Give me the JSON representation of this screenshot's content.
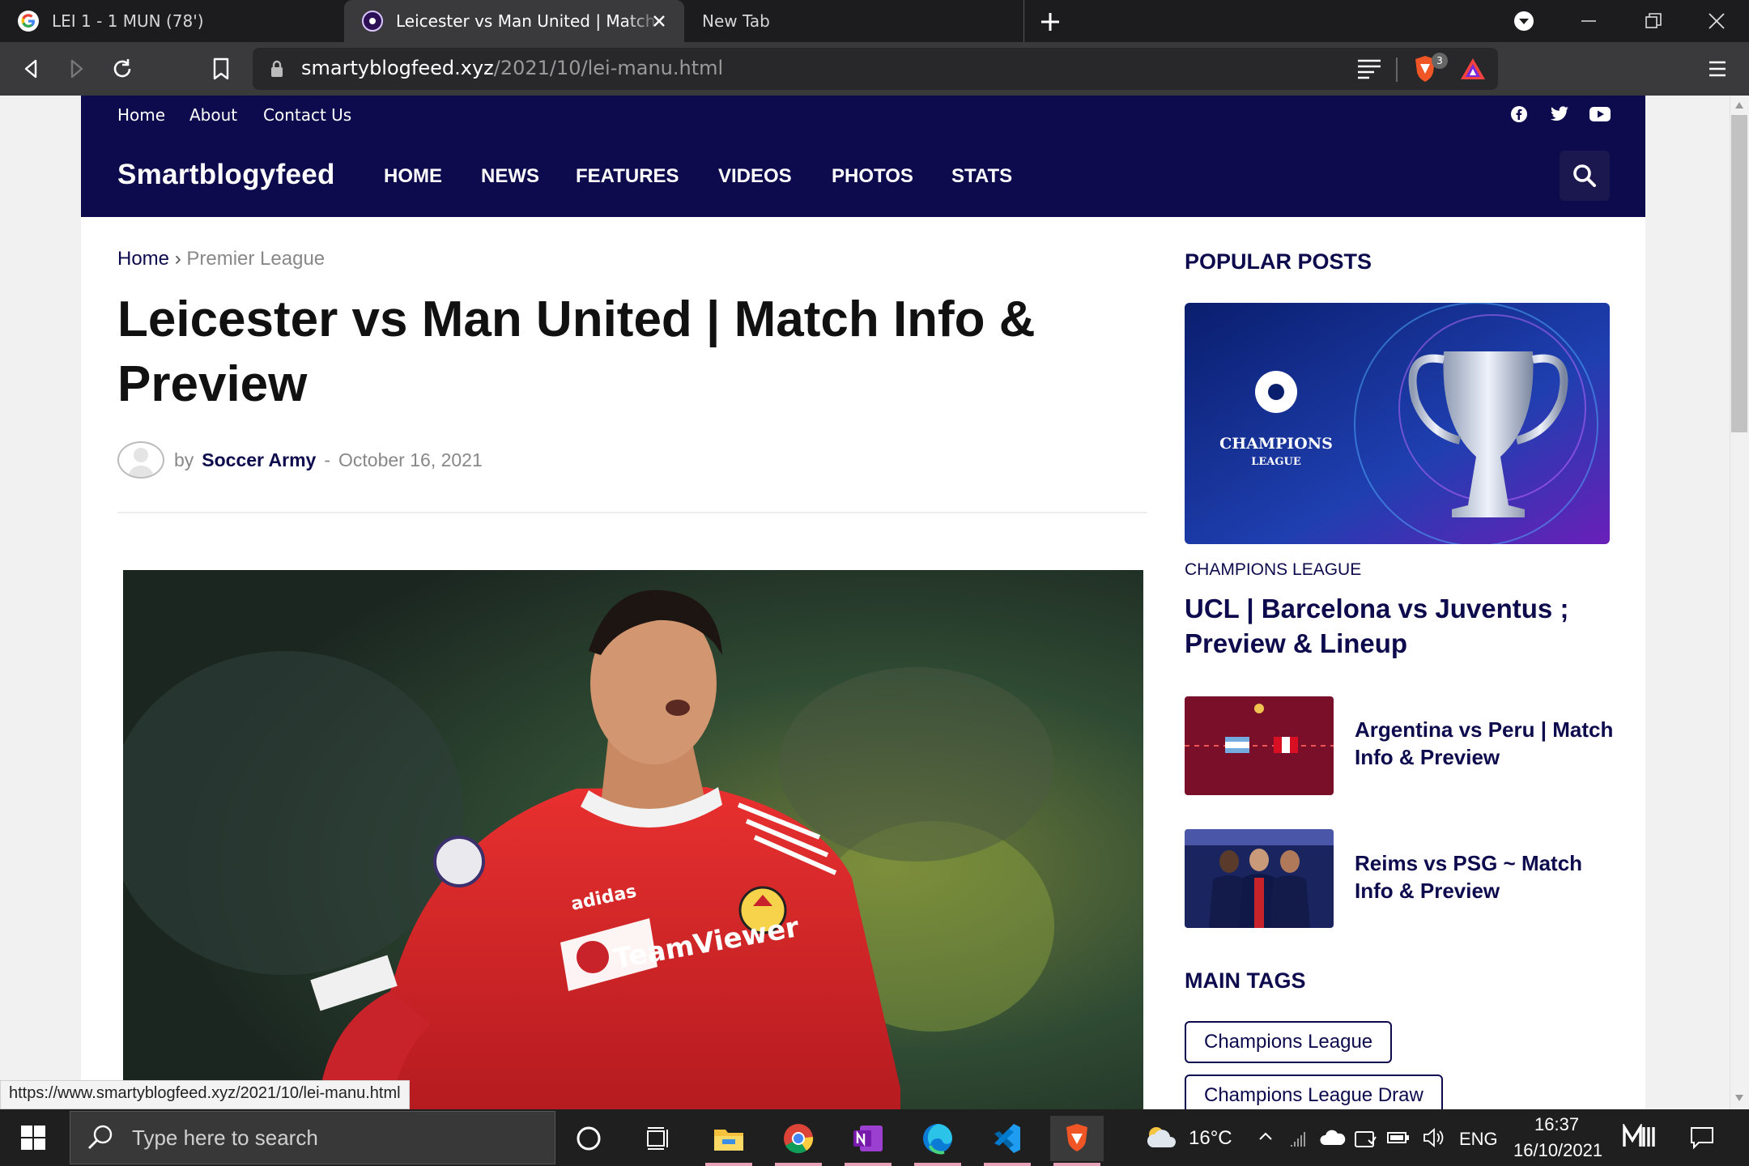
{
  "browser": {
    "tabs": [
      {
        "title": "LEI 1 - 1 MUN (78')",
        "active": false
      },
      {
        "title": "Leicester vs Man United | Match Info & Preview",
        "active": true
      },
      {
        "title": "New Tab",
        "active": false
      }
    ],
    "url_host": "smartyblogfeed.xyz",
    "url_path": "/2021/10/lei-manu.html",
    "shields_count": "3",
    "status_url": "https://www.smartyblogfeed.xyz/2021/10/lei-manu.html"
  },
  "site": {
    "top_links": [
      "Home",
      "About",
      "Contact Us"
    ],
    "social_icons": [
      "facebook-icon",
      "twitter-icon",
      "youtube-icon"
    ],
    "brand": "Smartblogyfeed",
    "nav": [
      "HOME",
      "NEWS",
      "FEATURES",
      "VIDEOS",
      "PHOTOS",
      "STATS"
    ],
    "accent_color": "#0d0b4d"
  },
  "article": {
    "breadcrumb_home": "Home",
    "breadcrumb_sep": "›",
    "breadcrumb_section": "Premier League",
    "title": "Leicester vs Man United | Match Info & Preview",
    "by": "by",
    "author": "Soccer Army",
    "dash": "-",
    "date": "October 16, 2021",
    "hero_kit_text": "TeamViewer"
  },
  "sidebar": {
    "popular_heading": "POPULAR POSTS",
    "featured_logo_text_1": "CHAMPIONS",
    "featured_logo_text_2": "LEAGUE",
    "featured_category": "CHAMPIONS LEAGUE",
    "featured_title": "UCL | Barcelona vs Juventus ; Preview & Lineup",
    "posts": [
      {
        "title": "Argentina vs Peru | Match Info & Preview"
      },
      {
        "title": "Reims vs PSG ~ Match Info & Preview"
      }
    ],
    "tags_heading": "MAIN TAGS",
    "tags": [
      "Champions League",
      "Champions League Draw"
    ]
  },
  "taskbar": {
    "search_placeholder": "Type here to search",
    "weather": "16°C",
    "language": "ENG",
    "time": "16:37",
    "date": "16/10/2021"
  }
}
